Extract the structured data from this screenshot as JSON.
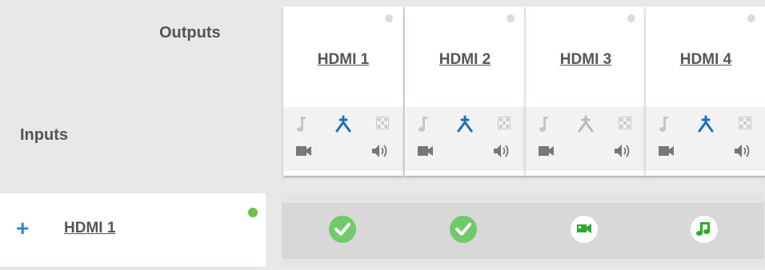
{
  "header": {
    "outputs_label": "Outputs",
    "inputs_label": "Inputs"
  },
  "outputs": [
    {
      "name": "HDMI 1",
      "route_active": true
    },
    {
      "name": "HDMI 2",
      "route_active": true
    },
    {
      "name": "HDMI 3",
      "route_active": false
    },
    {
      "name": "HDMI 4",
      "route_active": true
    }
  ],
  "inputs": [
    {
      "name": "HDMI 1",
      "expand_symbol": "+",
      "status": "connected"
    }
  ],
  "matrix": [
    [
      {
        "state": "routed-all",
        "icon": "check-icon"
      },
      {
        "state": "routed-all",
        "icon": "check-icon"
      },
      {
        "state": "video-only",
        "icon": "video-camera-icon"
      },
      {
        "state": "audio-only",
        "icon": "music-note-icon"
      }
    ]
  ],
  "colors": {
    "accent_blue": "#1f6fb5",
    "status_green": "#6cbf49",
    "check_green": "#72c96a",
    "media_green": "#2eaa2e",
    "icon_gray": "#9a9a9a"
  }
}
